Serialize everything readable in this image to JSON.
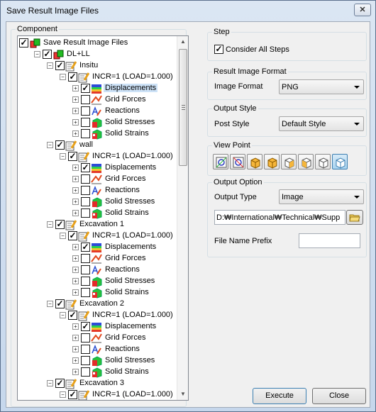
{
  "window": {
    "title": "Save Result Image Files",
    "close_label": "✕"
  },
  "component": {
    "legend": "Component"
  },
  "tree": [
    {
      "label": "Save Result Image Files",
      "level": 0,
      "expander": "",
      "check": "checked",
      "icon": "root-icon"
    },
    {
      "label": "DL+LL",
      "level": 1,
      "expander": "−",
      "check": "checked",
      "icon": "loadcase-icon"
    },
    {
      "label": "Insitu",
      "level": 2,
      "expander": "−",
      "check": "checked",
      "icon": "stage-icon"
    },
    {
      "label": "INCR=1 (LOAD=1.000)",
      "level": 3,
      "expander": "−",
      "check": "checked",
      "icon": "step-icon"
    },
    {
      "label": "Displacements",
      "level": 4,
      "expander": "+",
      "check": "checked",
      "icon": "displacements-icon",
      "selected": true
    },
    {
      "label": "Grid Forces",
      "level": 4,
      "expander": "+",
      "check": "unchecked",
      "icon": "grid-forces-icon"
    },
    {
      "label": "Reactions",
      "level": 4,
      "expander": "+",
      "check": "unchecked",
      "icon": "reactions-icon"
    },
    {
      "label": "Solid Stresses",
      "level": 4,
      "expander": "+",
      "check": "unchecked",
      "icon": "solid-stresses-icon"
    },
    {
      "label": "Solid Strains",
      "level": 4,
      "expander": "+",
      "check": "unchecked",
      "icon": "solid-strains-icon"
    },
    {
      "label": "wall",
      "level": 2,
      "expander": "−",
      "check": "checked",
      "icon": "stage-icon"
    },
    {
      "label": "INCR=1 (LOAD=1.000)",
      "level": 3,
      "expander": "−",
      "check": "checked",
      "icon": "step-icon"
    },
    {
      "label": "Displacements",
      "level": 4,
      "expander": "+",
      "check": "checked",
      "icon": "displacements-icon"
    },
    {
      "label": "Grid Forces",
      "level": 4,
      "expander": "+",
      "check": "unchecked",
      "icon": "grid-forces-icon"
    },
    {
      "label": "Reactions",
      "level": 4,
      "expander": "+",
      "check": "unchecked",
      "icon": "reactions-icon"
    },
    {
      "label": "Solid Stresses",
      "level": 4,
      "expander": "+",
      "check": "unchecked",
      "icon": "solid-stresses-icon"
    },
    {
      "label": "Solid Strains",
      "level": 4,
      "expander": "+",
      "check": "unchecked",
      "icon": "solid-strains-icon"
    },
    {
      "label": "Excavation 1",
      "level": 2,
      "expander": "−",
      "check": "checked",
      "icon": "stage-icon"
    },
    {
      "label": "INCR=1 (LOAD=1.000)",
      "level": 3,
      "expander": "−",
      "check": "checked",
      "icon": "step-icon"
    },
    {
      "label": "Displacements",
      "level": 4,
      "expander": "+",
      "check": "checked",
      "icon": "displacements-icon"
    },
    {
      "label": "Grid Forces",
      "level": 4,
      "expander": "+",
      "check": "unchecked",
      "icon": "grid-forces-icon"
    },
    {
      "label": "Reactions",
      "level": 4,
      "expander": "+",
      "check": "unchecked",
      "icon": "reactions-icon"
    },
    {
      "label": "Solid Stresses",
      "level": 4,
      "expander": "+",
      "check": "unchecked",
      "icon": "solid-stresses-icon"
    },
    {
      "label": "Solid Strains",
      "level": 4,
      "expander": "+",
      "check": "unchecked",
      "icon": "solid-strains-icon"
    },
    {
      "label": "Excavation 2",
      "level": 2,
      "expander": "−",
      "check": "checked",
      "icon": "stage-icon"
    },
    {
      "label": "INCR=1 (LOAD=1.000)",
      "level": 3,
      "expander": "−",
      "check": "checked",
      "icon": "step-icon"
    },
    {
      "label": "Displacements",
      "level": 4,
      "expander": "+",
      "check": "checked",
      "icon": "displacements-icon"
    },
    {
      "label": "Grid Forces",
      "level": 4,
      "expander": "+",
      "check": "unchecked",
      "icon": "grid-forces-icon"
    },
    {
      "label": "Reactions",
      "level": 4,
      "expander": "+",
      "check": "unchecked",
      "icon": "reactions-icon"
    },
    {
      "label": "Solid Stresses",
      "level": 4,
      "expander": "+",
      "check": "unchecked",
      "icon": "solid-stresses-icon"
    },
    {
      "label": "Solid Strains",
      "level": 4,
      "expander": "+",
      "check": "unchecked",
      "icon": "solid-strains-icon"
    },
    {
      "label": "Excavation 3",
      "level": 2,
      "expander": "−",
      "check": "checked",
      "icon": "stage-icon"
    },
    {
      "label": "INCR=1 (LOAD=1.000)",
      "level": 3,
      "expander": "−",
      "check": "checked",
      "icon": "step-icon"
    }
  ],
  "step": {
    "legend": "Step",
    "consider_all_label": "Consider All Steps",
    "consider_all_checked": true
  },
  "result_format": {
    "legend": "Result Image Format",
    "label": "Image Format",
    "value": "PNG"
  },
  "output_style": {
    "legend": "Output Style",
    "label": "Post Style",
    "value": "Default Style"
  },
  "view_point": {
    "legend": "View Point",
    "buttons": [
      "view-normal-icon",
      "view-reverse-icon",
      "view-iso-1-icon",
      "view-iso-2-icon",
      "view-iso-3-icon",
      "view-iso-4-icon",
      "view-iso-5-icon",
      "view-iso-6-icon"
    ]
  },
  "output_option": {
    "legend": "Output Option",
    "type_label": "Output Type",
    "type_value": "Image",
    "path_value": "D:₩International₩Technical₩Supp",
    "prefix_label": "File Name Prefix",
    "prefix_value": ""
  },
  "buttons": {
    "execute": "Execute",
    "close": "Close"
  },
  "colors": {
    "accent": "#3c7fb1",
    "selection": "#cde2f7"
  }
}
